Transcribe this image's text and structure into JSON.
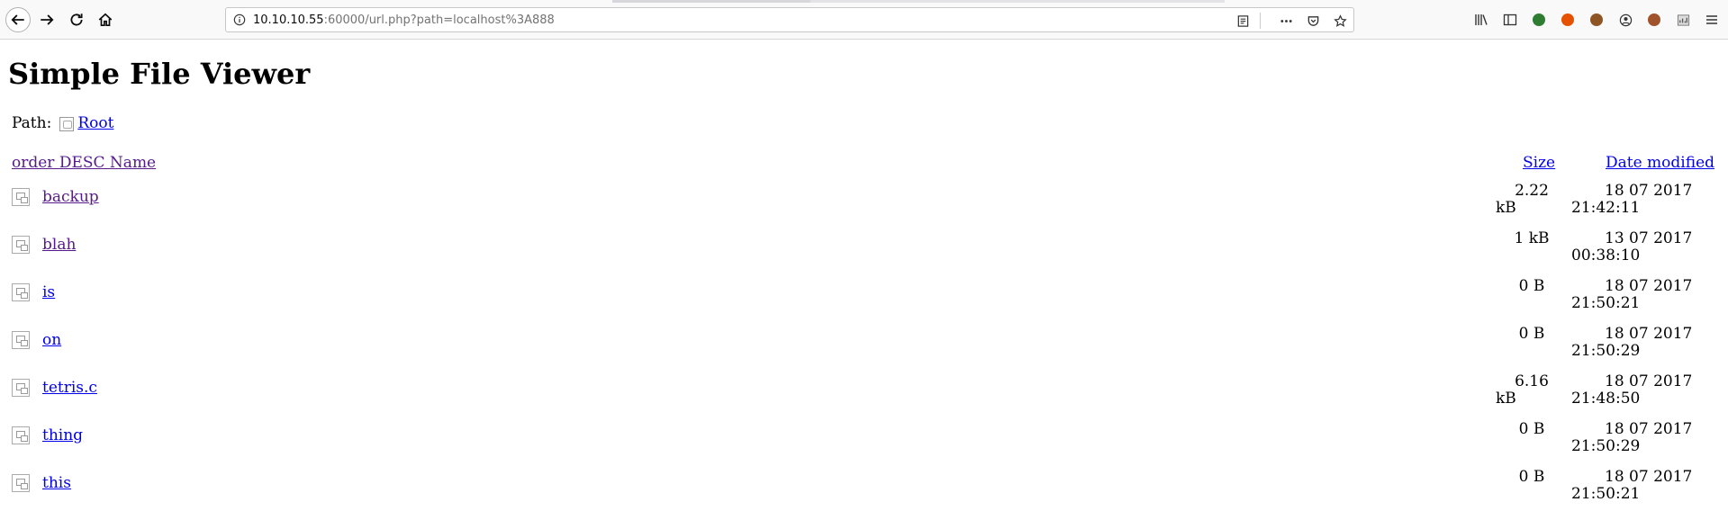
{
  "browser": {
    "url_host": "10.10.10.55",
    "url_rest": ":60000/url.php?path=localhost%3A888"
  },
  "page": {
    "title": "Simple File Viewer",
    "path_label": "Path:",
    "root_link": "Root"
  },
  "table": {
    "headers": {
      "name": "order DESC  Name",
      "size": "Size",
      "date": "Date modified"
    },
    "rows": [
      {
        "name": "backup",
        "size_top": "2.22",
        "size_bottom": "kB",
        "date_top": "18 07 2017",
        "date_bottom": "21:42:11"
      },
      {
        "name": "blah",
        "size_top": "1 kB",
        "size_bottom": "",
        "date_top": "13 07 2017",
        "date_bottom": "00:38:10"
      },
      {
        "name": "is",
        "size_top": "0 B",
        "size_bottom": "",
        "date_top": "18 07 2017",
        "date_bottom": "21:50:21"
      },
      {
        "name": "on",
        "size_top": "0 B",
        "size_bottom": "",
        "date_top": "18 07 2017",
        "date_bottom": "21:50:29"
      },
      {
        "name": "tetris.c",
        "size_top": "6.16",
        "size_bottom": "kB",
        "date_top": "18 07 2017",
        "date_bottom": "21:48:50"
      },
      {
        "name": "thing",
        "size_top": "0 B",
        "size_bottom": "",
        "date_top": "18 07 2017",
        "date_bottom": "21:50:29"
      },
      {
        "name": "this",
        "size_top": "0 B",
        "size_bottom": "",
        "date_top": "18 07 2017",
        "date_bottom": "21:50:21"
      }
    ]
  },
  "colors": {
    "link": "#0000ee",
    "visited_link": "#551a8b",
    "toolbar_bg": "#f9f9fa"
  }
}
